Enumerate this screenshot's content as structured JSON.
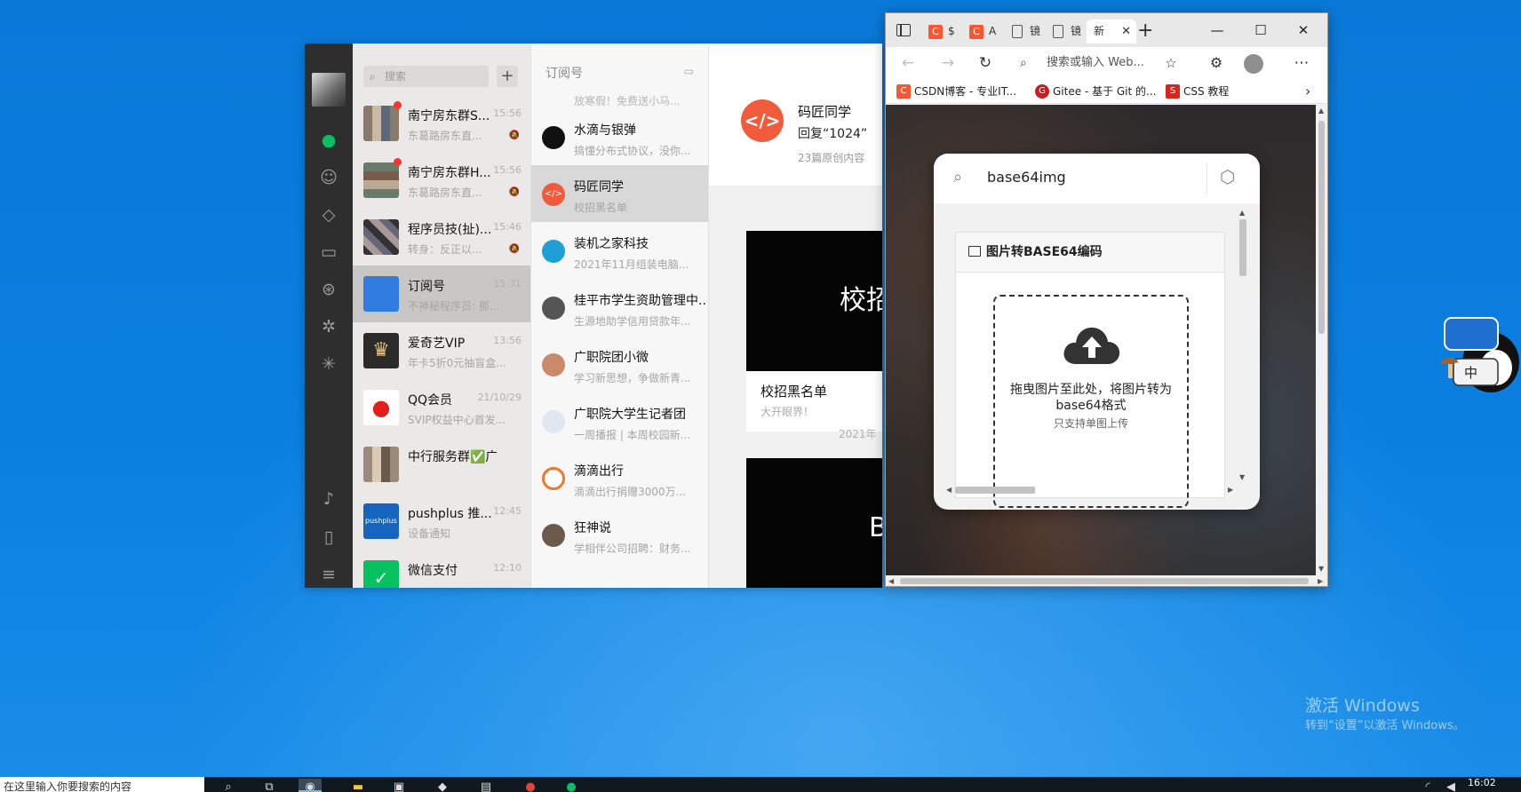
{
  "wechat": {
    "search_placeholder": "搜索",
    "plus": "+",
    "chats": [
      {
        "name": "南宁房东群S...",
        "time": "15:56",
        "preview": "东葛路房东直...",
        "unread": true,
        "muted": true
      },
      {
        "name": "南宁房东群H...",
        "time": "15:56",
        "preview": "东葛路房东直...",
        "unread": true,
        "muted": true
      },
      {
        "name": "程序员技(扯)...",
        "time": "15:46",
        "preview": "转身：反正以...",
        "unread": false,
        "muted": true
      },
      {
        "name": "订阅号",
        "time": "15:31",
        "preview": "不神秘程序员: 那...",
        "unread": false,
        "muted": false
      },
      {
        "name": "爱奇艺VIP",
        "time": "13:56",
        "preview": "年卡5折0元抽盲盒...",
        "unread": false,
        "muted": false
      },
      {
        "name": "QQ会员",
        "time": "21/10/29",
        "preview": "SVIP权益中心首发...",
        "unread": false,
        "muted": false
      },
      {
        "name": "中行服务群✅广...",
        "time": "",
        "preview": "",
        "unread": false,
        "muted": false
      },
      {
        "name": "pushplus 推...",
        "time": "12:45",
        "preview": "设备通知",
        "unread": false,
        "muted": false
      },
      {
        "name": "微信支付",
        "time": "12:10",
        "preview": "",
        "unread": false,
        "muted": false
      }
    ],
    "subscriptions": {
      "header": "订阅号",
      "cut_preview": "放寒假！免费送小马...",
      "items": [
        {
          "name": "水滴与银弹",
          "preview": "搞懂分布式协议，没你..."
        },
        {
          "name": "码匠同学",
          "preview": "校招黑名单"
        },
        {
          "name": "装机之家科技",
          "preview": "2021年11月组装电脑..."
        },
        {
          "name": "桂平市学生资助管理中...",
          "preview": "生源地助学信用贷款年..."
        },
        {
          "name": "广职院团小微",
          "preview": "学习新思想，争做新青..."
        },
        {
          "name": "广职院大学生记者团",
          "preview": "一周播报 | 本周校园新..."
        },
        {
          "name": "滴滴出行",
          "preview": "滴滴出行捐赠3000万..."
        },
        {
          "name": "狂神说",
          "preview": "学相伴公司招聘：财务..."
        }
      ]
    },
    "account": {
      "name": "码匠同学",
      "reply": "回复“1024”",
      "count": "23篇原创内容",
      "logo_text": "</>"
    },
    "articles": [
      {
        "img_text": "校招",
        "title": "校招黑名单",
        "sub": "大开眼界！"
      },
      {
        "img_text": "B",
        "title": "",
        "sub": ""
      }
    ],
    "date_label": "2021年"
  },
  "edge": {
    "tabs": [
      {
        "icon": "csdn",
        "label": "$"
      },
      {
        "icon": "csdn",
        "label": "A"
      },
      {
        "icon": "doc",
        "label": "镜"
      },
      {
        "icon": "doc",
        "label": "镜"
      },
      {
        "icon": "none",
        "label": "新"
      }
    ],
    "new_tab": "+",
    "address_placeholder": "搜索或输入 Web...",
    "bookmarks": [
      {
        "label": "CSDN博客 - 专业IT...",
        "color": "#fc5531",
        "glyph": "C"
      },
      {
        "label": "Gitee - 基于 Git 的...",
        "color": "#c71d23",
        "glyph": "G"
      },
      {
        "label": "CSS 教程",
        "color": "#d9261c",
        "glyph": "S"
      }
    ],
    "popup": {
      "query": "base64img",
      "panel_title": "图片转BASE64编码",
      "drop_text": "拖曳图片至此处，将图片转为base64格式",
      "drop_sub": "只支持单图上传"
    }
  },
  "watermark": {
    "line1": "激活 Windows",
    "line2": "转到“设置”以激活 Windows。"
  },
  "taskbar": {
    "search_text": "在这里输入你要搜索的内容",
    "clock": "16:02"
  },
  "colors": {
    "wechat_green": "#07c160",
    "unread_red": "#f43530",
    "maajiang_orange": "#f05b3c",
    "desktop_blue": "#0a78d7"
  }
}
